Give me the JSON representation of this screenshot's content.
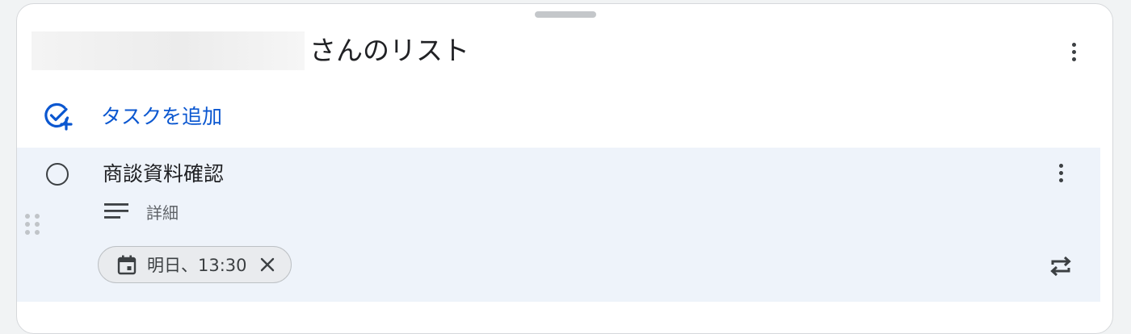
{
  "list": {
    "title": "さんのリスト",
    "add_task_label": "タスクを追加"
  },
  "task": {
    "title": "商談資料確認",
    "details_label": "詳細",
    "date_chip_label": "明日、13:30"
  },
  "icons": {
    "menu": "more-vert-icon",
    "add_task": "add-task-icon",
    "checkbox": "circle-outline-icon",
    "details": "notes-icon",
    "calendar": "calendar-icon",
    "clear": "close-icon",
    "repeat": "repeat-icon",
    "drag": "drag-indicator-icon"
  },
  "colors": {
    "accent": "#0b57d0",
    "task_row_bg": "#eef3fa",
    "chip_bg": "#e9ebee",
    "text": "#202124"
  }
}
